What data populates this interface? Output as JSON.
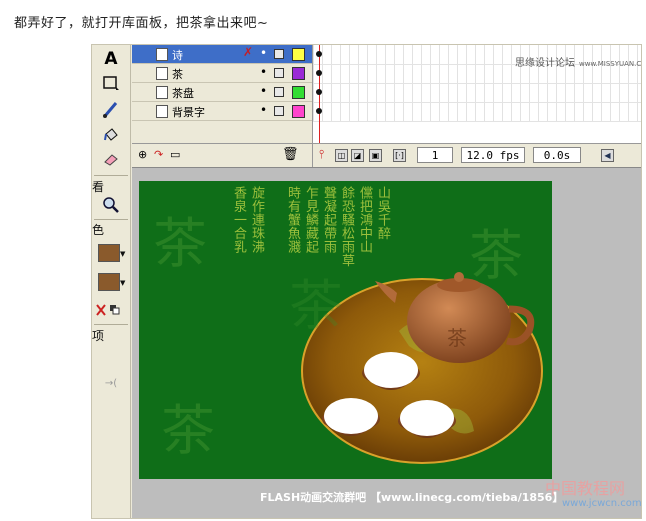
{
  "intro_text": "都弄好了，就打开库面板，把茶拿出来吧~",
  "toolbox": {
    "view_label": "看",
    "colors_label": "色",
    "options_label": "项",
    "stroke_color": "#8a5a2c",
    "fill_color": "#8a5a2c"
  },
  "layers": [
    {
      "name": "诗",
      "color": "#ffff44",
      "selected": true
    },
    {
      "name": "茶",
      "color": "#9a2ad6",
      "selected": false
    },
    {
      "name": "茶盘",
      "color": "#33dd33",
      "selected": false
    },
    {
      "name": "背景字",
      "color": "#ff44cc",
      "selected": false
    }
  ],
  "timeline": {
    "watermark": "思缘设计论坛",
    "watermark_url": "www.MISSYUAN.COM",
    "frame": "1",
    "fps": "12.0 fps",
    "time": "0.0s"
  },
  "stage": {
    "poem_columns": [
      "山吳千醉",
      "儻把鴻中山",
      "餘恐騷松雨草",
      "聲凝起帶雨",
      "乍見鱗藏起",
      "時有蟹魚濺",
      "旋作連珠沸",
      "香泉一合乳"
    ],
    "pattern_char": "茶",
    "teapot_char": "茶",
    "background_color": "#0f6e18"
  },
  "footer": {
    "caption": "FLASH动画交流群吧 【www.linecg.com/tieba/1856】",
    "site_name": "中国教程网",
    "site_url": "www.jcwcn.com"
  }
}
